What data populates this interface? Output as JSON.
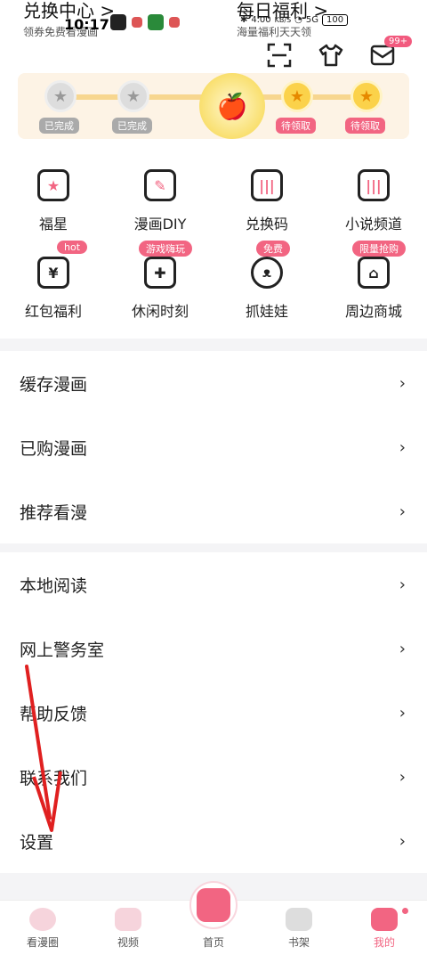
{
  "header": {
    "left_title": "兑换中心 >",
    "left_subtitle": "领券免费看漫画",
    "right_title": "每日福利 >",
    "right_subtitle": "海量福利天天领"
  },
  "statusbar": {
    "time": "10:17",
    "net_speed": "4.00",
    "net_unit": "KB/S",
    "signal": "5G",
    "battery": "100"
  },
  "actions": {
    "mail_badge": "99+"
  },
  "progress": {
    "nodes": [
      {
        "label": "已完成",
        "state": "done"
      },
      {
        "label": "已完成",
        "state": "done"
      },
      {
        "label": "待领取",
        "state": "pending"
      },
      {
        "label": "待领取",
        "state": "pending"
      }
    ]
  },
  "grid": {
    "row1": [
      {
        "label": "福星",
        "icon": "gift-bag-icon"
      },
      {
        "label": "漫画DIY",
        "icon": "edit-note-icon"
      },
      {
        "label": "兑换码",
        "icon": "ticket-icon"
      },
      {
        "label": "小说频道",
        "icon": "book-ticket-icon"
      }
    ],
    "row2": [
      {
        "label": "红包福利",
        "icon": "red-envelope-icon",
        "tag": "hot"
      },
      {
        "label": "休闲时刻",
        "icon": "gamepad-icon",
        "tag": "游戏嗨玩"
      },
      {
        "label": "抓娃娃",
        "icon": "claw-doll-icon",
        "tag": "免费"
      },
      {
        "label": "周边商城",
        "icon": "shop-icon",
        "tag": "限量抢购"
      }
    ]
  },
  "list1": [
    "缓存漫画",
    "已购漫画",
    "推荐看漫"
  ],
  "list2": [
    "本地阅读",
    "网上警务室",
    "帮助反馈",
    "联系我们",
    "设置"
  ],
  "tabs": [
    {
      "label": "看漫圈"
    },
    {
      "label": "视频"
    },
    {
      "label": "首页"
    },
    {
      "label": "书架"
    },
    {
      "label": "我的"
    }
  ],
  "colors": {
    "accent": "#f26582",
    "arrow": "#e02020"
  }
}
